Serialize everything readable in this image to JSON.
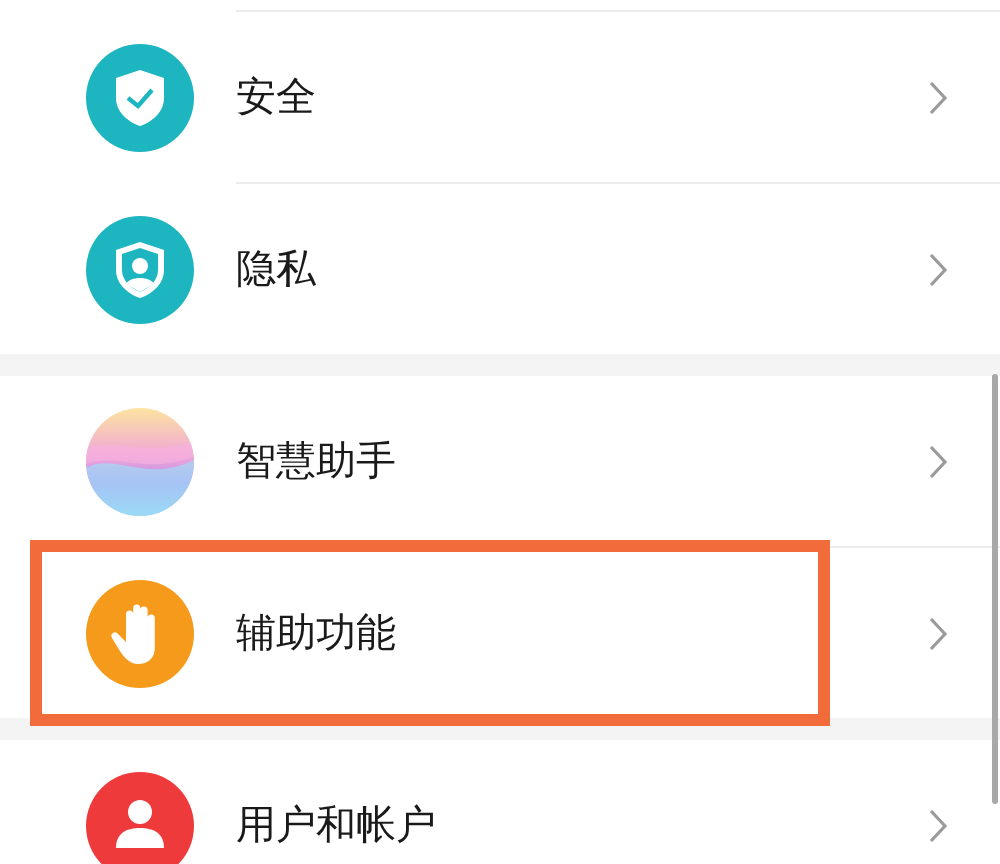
{
  "groups": [
    {
      "items": [
        {
          "label": "安全",
          "kind": "security"
        },
        {
          "label": "隐私",
          "kind": "privacy"
        }
      ]
    },
    {
      "items": [
        {
          "label": "智慧助手",
          "kind": "assistant"
        },
        {
          "label": "辅助功能",
          "kind": "accessibility",
          "highlighted": true
        }
      ]
    },
    {
      "items": [
        {
          "label": "用户和帐户",
          "kind": "user"
        }
      ]
    }
  ]
}
